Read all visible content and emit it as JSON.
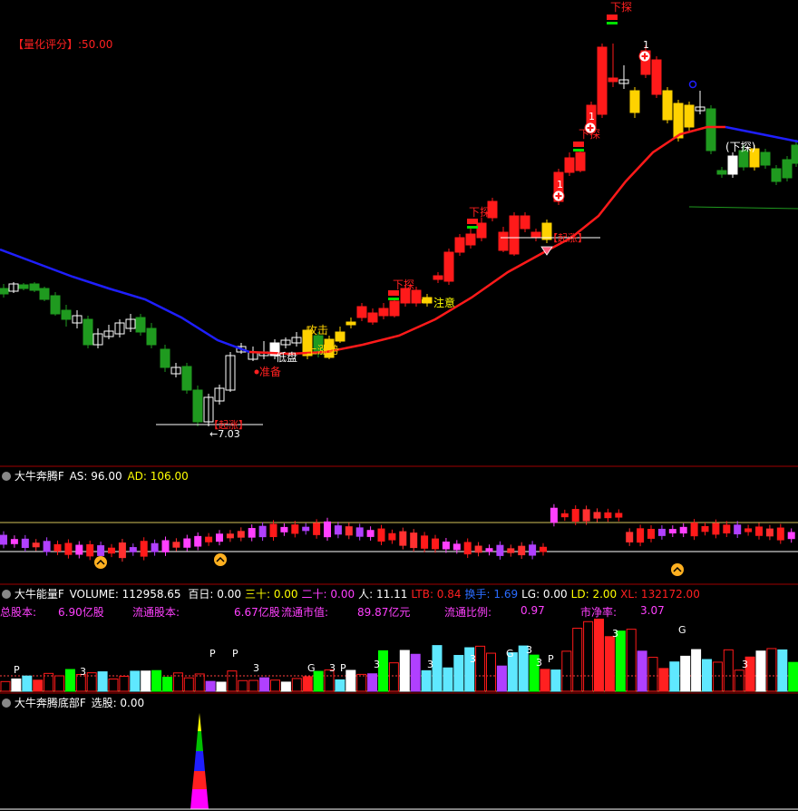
{
  "colors": {
    "bg": "#000000",
    "up": "#ff1a1a",
    "down": "#1f9a1f",
    "highlight": "#ffd200",
    "neutral_candle": "#ffffff",
    "ma_red": "#ff1a1a",
    "ma_blue": "#1f1fff",
    "divider": "#a00000",
    "panel_line": "#ffffff",
    "label_red": "#ff2020",
    "label_yellow": "#ffff00",
    "label_white": "#ffffff",
    "label_blue": "#2a6cff",
    "label_magenta": "#ff40ff",
    "label_pink": "#ff4fa0",
    "label_green": "#00ff00"
  },
  "main": {
    "score_label": "【量化评分】:50.00",
    "low_price": "←7.03",
    "markers": {
      "xiatan": "下探",
      "zhunbei": "准备",
      "zhuyi": "注意",
      "diji": "低盘",
      "gongji": "攻击",
      "shangsheng": "上涨势",
      "qizhang": "【起涨】",
      "one": "1",
      "xiatan_paren": "(下探)"
    }
  },
  "panel2": {
    "title": "大牛奔腾F",
    "as_label": "AS: 96.00",
    "ad_label": "AD: 106.00"
  },
  "panel3": {
    "title": "大牛能量F",
    "volume": "VOLUME: 112958.65",
    "fields": [
      {
        "text": "百日: 0.00",
        "color": "#ffffff"
      },
      {
        "text": "三十: 0.00",
        "color": "#ffff00"
      },
      {
        "text": "二十: 0.00",
        "color": "#ff40ff"
      },
      {
        "text": "人: 11.11",
        "color": "#ffffff"
      },
      {
        "text": "LTB: 0.84",
        "color": "#ff2020"
      },
      {
        "text": "换手: 1.69",
        "color": "#2a6cff"
      },
      {
        "text": "LG: 0.00",
        "color": "#ffffff"
      },
      {
        "text": "LD: 2.00",
        "color": "#ffff00"
      },
      {
        "text": "XL: 132172.00",
        "color": "#ff2020"
      }
    ],
    "info": [
      {
        "label": "总股本:",
        "value": "6.90亿股"
      },
      {
        "label": "流通股本:",
        "value": "6.67亿股"
      },
      {
        "label": "流通市值:",
        "value": "89.87亿元"
      },
      {
        "label": "流通比例:",
        "value": "0.97"
      },
      {
        "label": "市净率:",
        "value": "3.07"
      }
    ],
    "letters": [
      "P",
      "3",
      "P",
      "P",
      "3",
      "G",
      "3",
      "P",
      "3",
      "3",
      "3",
      "G",
      "3",
      "3",
      "P",
      "3",
      "G",
      "3"
    ]
  },
  "panel4": {
    "title": "大牛奔腾底部F",
    "value_label": "选股: 0.00"
  },
  "chart_data": [
    {
      "type": "candlestick",
      "title": "",
      "price_low_marked": 7.03,
      "candles": [
        {
          "o": 0,
          "c": 0,
          "h": 0,
          "l": 0
        }
      ],
      "series": [
        {
          "name": "",
          "values": []
        }
      ],
      "ylim": []
    },
    {
      "type": "bar",
      "title": "大牛奔腾F",
      "series": [
        {
          "name": "AS",
          "values": [
            96.0
          ]
        },
        {
          "name": "AD",
          "values": [
            106.0
          ]
        }
      ]
    },
    {
      "type": "bar",
      "title": "大牛能量F",
      "series": [
        {
          "name": "VOLUME",
          "values": [
            112958.65
          ]
        }
      ]
    },
    {
      "type": "bar",
      "title": "大牛奔腾底部F",
      "series": [
        {
          "name": "选股",
          "values": [
            0.0
          ]
        }
      ]
    }
  ]
}
